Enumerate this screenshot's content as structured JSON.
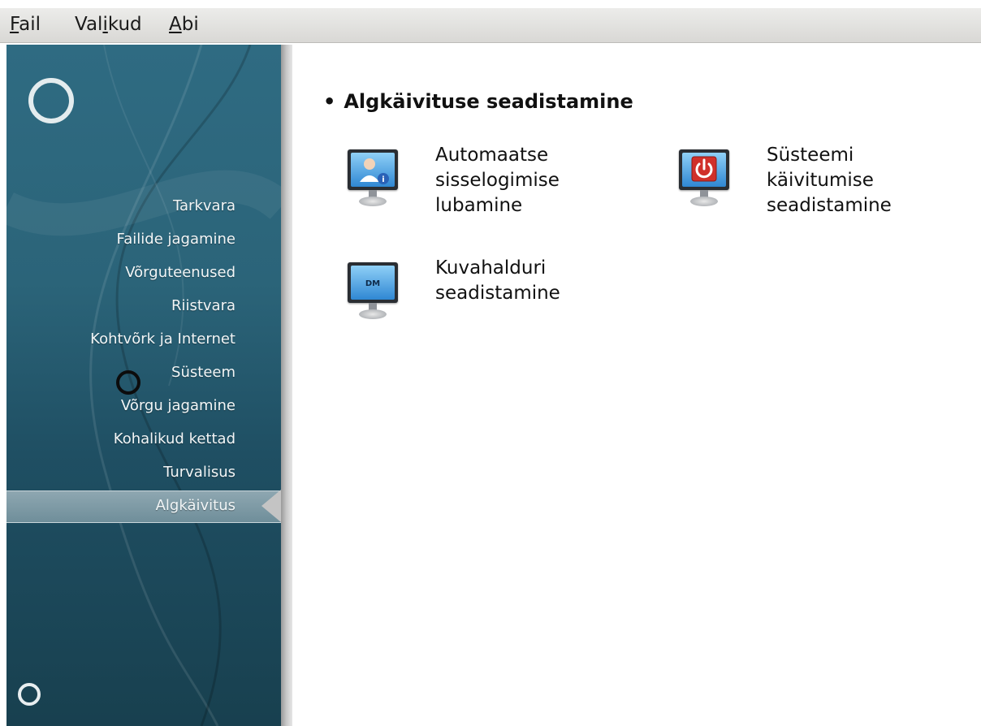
{
  "menubar": {
    "items": [
      "Fail",
      "Valikud",
      "Abi"
    ],
    "underline": [
      "F",
      "i",
      "A"
    ]
  },
  "sidebar": {
    "items": [
      {
        "label": "Tarkvara"
      },
      {
        "label": "Failide jagamine"
      },
      {
        "label": "Võrguteenused"
      },
      {
        "label": "Riistvara"
      },
      {
        "label": "Kohtvõrk ja Internet"
      },
      {
        "label": "Süsteem"
      },
      {
        "label": "Võrgu jagamine"
      },
      {
        "label": "Kohalikud kettad"
      },
      {
        "label": "Turvalisus"
      },
      {
        "label": "Algkäivitus",
        "selected": true
      }
    ]
  },
  "main": {
    "section_title": "Algkäivituse seadistamine",
    "tools": [
      {
        "label": "Automaatse sisselogimise lubamine",
        "lines": [
          "Automaatse",
          "sisselogimise",
          "lubamine"
        ],
        "icon": "autologin-user-icon"
      },
      {
        "label": "Süsteemi käivitumise seadistamine",
        "lines": [
          "Süsteemi",
          "käivitumise",
          "seadistamine"
        ],
        "icon": "boot-power-icon"
      },
      {
        "label": "Kuvahalduri seadistamine",
        "lines": [
          "Kuvahalduri",
          "seadistamine"
        ],
        "icon": "display-manager-icon",
        "icon_text": "DM"
      }
    ]
  },
  "colors": {
    "sidebar": "#2b6479",
    "selected": "#7d9aa5",
    "accent_red": "#d0302a",
    "accent_blue": "#3a8fd6"
  }
}
